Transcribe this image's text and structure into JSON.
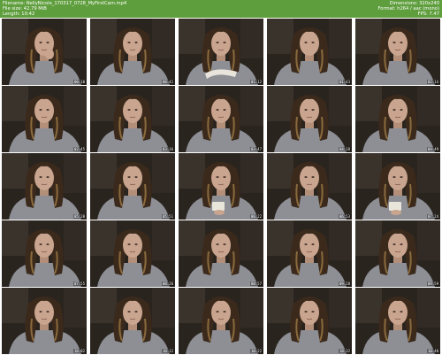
{
  "header": {
    "filename": "Filename: NellyNicole_170317_0728_MyFirstCam.mp4",
    "filesize": "File size: 42.79 MiB",
    "length": "Length: 10:42",
    "dimensions": "Dimensions: 320x240",
    "format": "Format: h264 / aac (mono)",
    "fps": "FPS: 7.47"
  },
  "thumbnails": [
    {
      "timestamp": "00:10",
      "variant": "hand-chin"
    },
    {
      "timestamp": "00:41",
      "variant": "normal"
    },
    {
      "timestamp": "01:12",
      "variant": "arm-down"
    },
    {
      "timestamp": "01:43",
      "variant": "hand-mouth"
    },
    {
      "timestamp": "02:14",
      "variant": "normal"
    },
    {
      "timestamp": "02:45",
      "variant": "normal"
    },
    {
      "timestamp": "03:16",
      "variant": "normal"
    },
    {
      "timestamp": "03:47",
      "variant": "normal"
    },
    {
      "timestamp": "04:18",
      "variant": "normal"
    },
    {
      "timestamp": "04:49",
      "variant": "normal"
    },
    {
      "timestamp": "05:20",
      "variant": "normal"
    },
    {
      "timestamp": "05:51",
      "variant": "normal"
    },
    {
      "timestamp": "06:22",
      "variant": "phone"
    },
    {
      "timestamp": "06:53",
      "variant": "normal"
    },
    {
      "timestamp": "07:24",
      "variant": "phone"
    },
    {
      "timestamp": "07:55",
      "variant": "normal"
    },
    {
      "timestamp": "08:26",
      "variant": "normal"
    },
    {
      "timestamp": "08:57",
      "variant": "normal"
    },
    {
      "timestamp": "09:28",
      "variant": "normal"
    },
    {
      "timestamp": "09:59",
      "variant": "normal"
    },
    {
      "timestamp": "10:02",
      "variant": "normal"
    },
    {
      "timestamp": "10:12",
      "variant": "normal"
    },
    {
      "timestamp": "10:22",
      "variant": "normal"
    },
    {
      "timestamp": "10:32",
      "variant": "normal"
    },
    {
      "timestamp": "10:40",
      "variant": "normal"
    }
  ],
  "colors": {
    "header_bg": "#5f9e3d",
    "background_wall": "#2a241f",
    "hair": "#3b2a1c",
    "hair_highlight": "#8a6a3c",
    "skin": "#c9a48e",
    "shirt": "#8d8f95",
    "phone_glow": "#e8e6da"
  }
}
